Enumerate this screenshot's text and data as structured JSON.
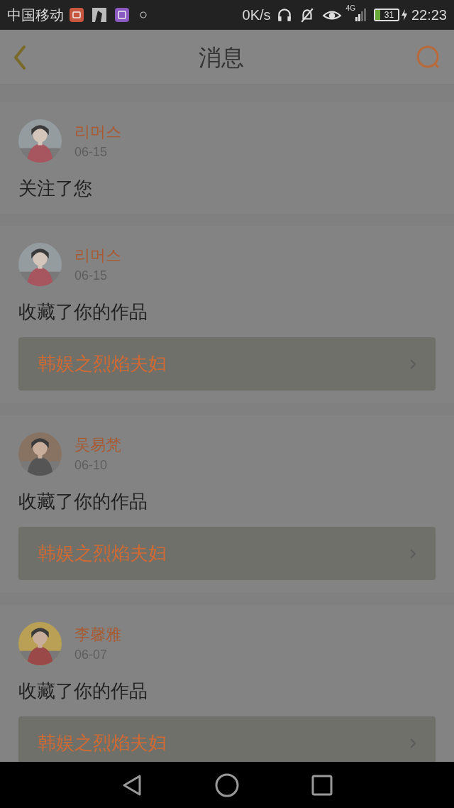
{
  "status_bar": {
    "carrier": "中国移动",
    "speed": "0K/s",
    "network": "4G",
    "battery": "31",
    "time": "22:23"
  },
  "header": {
    "title": "消息"
  },
  "messages": [
    {
      "user": "리머스",
      "date": "06-15",
      "action": "关注了您"
    },
    {
      "user": "리머스",
      "date": "06-15",
      "action": "收藏了你的作品",
      "work": "韩娱之烈焰夫妇"
    },
    {
      "user": "吴易梵",
      "date": "06-10",
      "action": "收藏了你的作品",
      "work": "韩娱之烈焰夫妇"
    },
    {
      "user": "李馨雅",
      "date": "06-07",
      "action": "收藏了你的作品",
      "work": "韩娱之烈焰夫妇"
    }
  ]
}
